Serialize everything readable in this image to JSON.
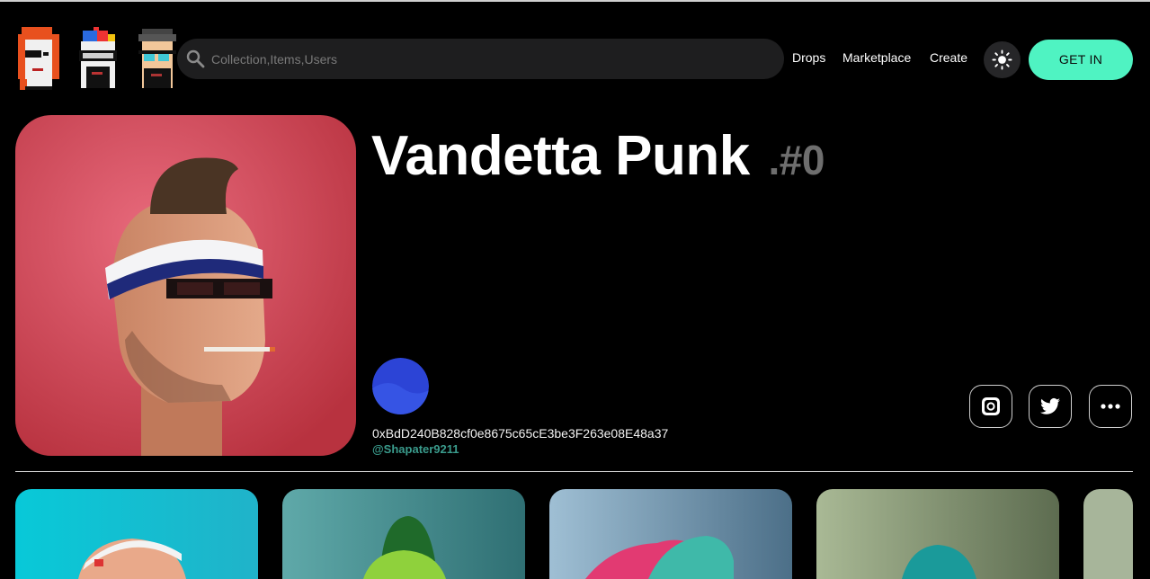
{
  "search": {
    "placeholder": "Collection,Items,Users"
  },
  "nav": {
    "drops": "Drops",
    "marketplace": "Marketplace",
    "create": "Create"
  },
  "cta": {
    "label": "GET IN",
    "color": "#4ff3c2"
  },
  "icons": {
    "search": "search-icon",
    "theme": "sun-icon",
    "instagram": "instagram-icon",
    "twitter": "twitter-icon",
    "more": "more-horizontal-icon"
  },
  "nft": {
    "name": "Vandetta Punk",
    "number": ".#0",
    "owner_address": "0xBdD240B828cf0e8675c65cE3be3F263e08E48a37",
    "owner_handle": "@Shapater9211"
  },
  "colors": {
    "background": "#000000",
    "handle": "#3a9b8c",
    "accent": "#4ff3c2"
  }
}
